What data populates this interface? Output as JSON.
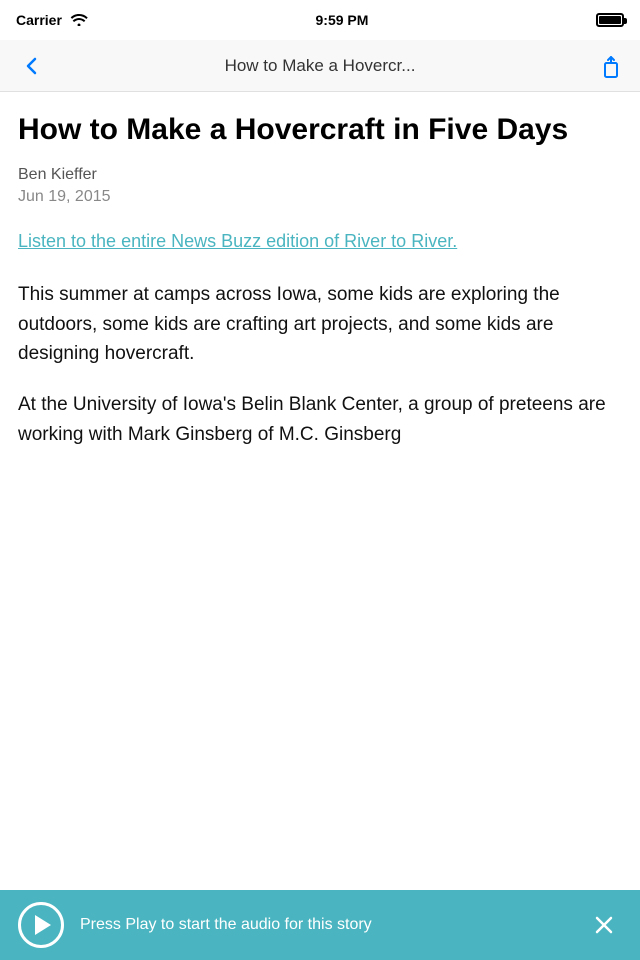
{
  "statusBar": {
    "carrier": "Carrier",
    "wifi": "wifi",
    "time": "9:59 PM"
  },
  "navBar": {
    "title": "How to Make a Hovercr...",
    "backLabel": "back",
    "shareLabel": "share"
  },
  "article": {
    "title": "How to Make a Hovercraft in Five Days",
    "author": "Ben Kieffer",
    "date": "Jun 19, 2015",
    "linkText": "Listen to the entire News Buzz edition of River to River.",
    "body1": "This summer at camps across Iowa, some kids are exploring the outdoors, some kids are crafting art projects, and some kids are designing hovercraft.",
    "body2": "At the University of Iowa's Belin Blank Center, a group of preteens are working with Mark Ginsberg of M.C. Ginsberg"
  },
  "audioBar": {
    "playLabel": "play",
    "text": "Press Play to start the audio for this story",
    "closeLabel": "close"
  }
}
